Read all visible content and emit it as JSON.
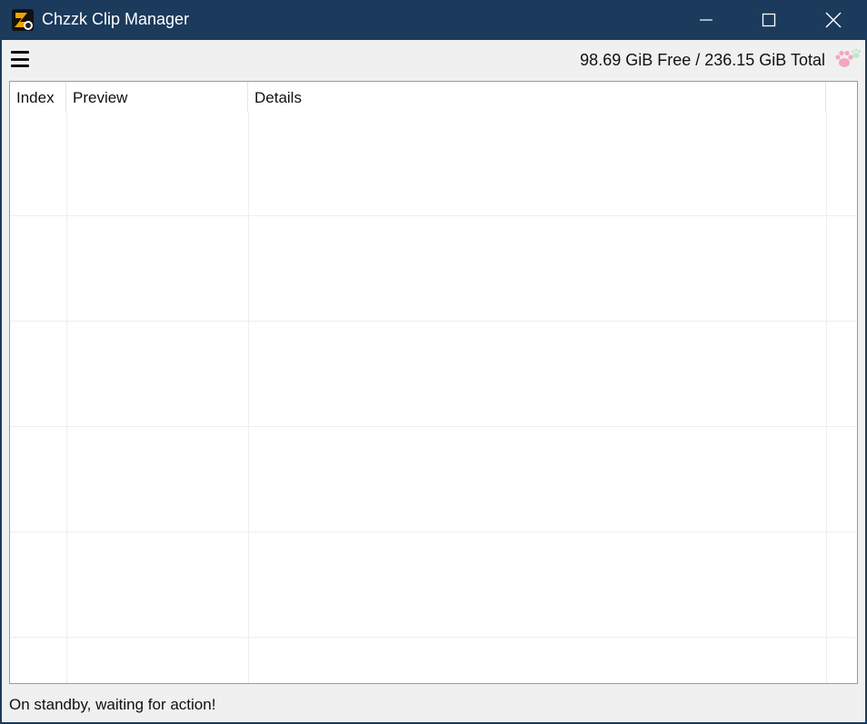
{
  "window": {
    "title": "Chzzk Clip Manager",
    "app_icon": "chzzk-logo-icon",
    "accent_color": "#1b3a5c"
  },
  "toolbar": {
    "menu_icon": "hamburger-menu-icon",
    "disk_info": "98.69 GiB Free / 236.15 GiB Total",
    "paw_icon": "paw-icon"
  },
  "list": {
    "columns": [
      "Index",
      "Preview",
      "Details",
      ""
    ],
    "rows": []
  },
  "status": {
    "text": "On standby, waiting for action!"
  }
}
